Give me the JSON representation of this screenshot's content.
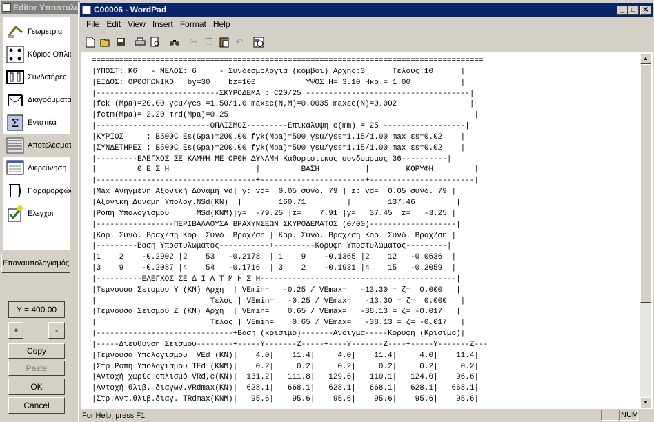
{
  "editor": {
    "title": "Editor Υποστυλω",
    "tools": [
      {
        "label": "Γεωμετρία",
        "icon": "geometry-icon"
      },
      {
        "label": "Κύριος Οπλισ",
        "icon": "main-rebar-icon"
      },
      {
        "label": "Συνδετήρες",
        "icon": "stirrups-icon"
      },
      {
        "label": "Διαγράμματα",
        "icon": "diagrams-icon"
      },
      {
        "label": "Εντατικά",
        "icon": "sum-icon"
      },
      {
        "label": "Αποτελέσματ",
        "icon": "results-icon"
      },
      {
        "label": "Διερεύνηση",
        "icon": "investigation-icon"
      },
      {
        "label": "Παραμορφώς",
        "icon": "deformation-icon"
      },
      {
        "label": "Ελεγχοι",
        "icon": "checks-icon"
      }
    ],
    "recalc_label": "Επαναυπολογισμός",
    "y_value": "Y = 400.00",
    "plus": "+",
    "minus": "-",
    "copy": "Copy",
    "paste": "Paste",
    "ok": "OK",
    "cancel": "Cancel"
  },
  "wordpad": {
    "title": "C00006 - WordPad",
    "menu": [
      "File",
      "Edit",
      "View",
      "Insert",
      "Format",
      "Help"
    ],
    "status": "For Help, press F1",
    "num": "NUM",
    "doc_lines": [
      "======================================================================================",
      "|ΥΠΟΣΤ: Κ6   - ΜΕΛΟΣ: 6     - Συνδεσμολογια (κομβοι) Αρχης:3      Τελους:10      |",
      "|ΕΙΔΟΣ: ΟΡΘΟΓΩΝΙΚΟ   by=30    bz=100           ΥΨΟΣ Η= 3.10 Ηκρ.= 1.00           |",
      "|---------------------------ΣΚΥΡΟΔΕΜΑ : C20/25 ------------------------------------|",
      "|fck (Mpa)=20.00 γcu/γcs =1.50/1.0 maxεc(N,M)=0.0035 maxεc(N)=0.002                |",
      "|fctm(Mpa)= 2.20 τrd(Mpa)=0.25                                                      |",
      "|-------------------------ΟΠΛΙΣΜΟΣ---------Επικαλυψη c(mm) = 25 ------------------|",
      "|ΚΥΡΙΟΣ     : B500C Es(Gpa)=200.00 fyk(Mpa)=500 γsu/γss=1.15/1.00 max εs=0.02    |",
      "|ΣΥΝΔΕΤΗΡΕΣ : B500C Es(Gpa)=200.00 fyk(Mpa)=500 γsu/γss=1.15/1.00 max εs=0.02    |",
      "|---------ΕΛΕΓΧΟΣ ΣΕ ΚΑΜΨΗ ΜΕ ΟΡΘΗ ΔΥΝΑΜΗ Καθοριστικος συνδυασμος 36----------|",
      "|         Θ Ε Σ Η                   |         ΒΑΣΗ          |        ΚΟΡΥΦΗ         |",
      "|-----------------------------------+-----------------------+-----------------------|",
      "|Max Ανηγμένη Αξονική Δύναμη vd| y: vd=  0.05 συνδ. 79 | z: vd=  0.05 συνδ. 79 |",
      "|Αξονικη Δυναμη Υπολογ.NSd(KN)  |        160.71         |        137.46         |",
      "|Ροπη Υπολογισμου      MSd(KNM)|y=  -79.25 |z=    7.91 |y=   37.45 |z=   -3.25 |",
      "|-----------------ΠΕΡΙΒΑΛΛΟΥΣΑ ΒΡΑΧΥΝΣΕΩΝ ΣΚΥΡΟΔΕΜΑΤΟΣ (0/00)-------------------|",
      "|Κορ. Συνδ. Βραχ/ση Κορ. Συνδ. Βραχ/ση | Κορ. Συνδ. Βραχ/ση Κορ. Συνδ. Βραχ/ση |",
      "|---------Βαση Υποστυλωματος-----------+---------Κορυφη Υποστυλωματος---------|",
      "|1    2    -0.2902 |2    53   -0.2178  | 1    9    -0.1365 |2    12   -0.0636  |",
      "|3    9    -0.2087 |4    54   -0.1716  | 3    2    -0.1931 |4    15   -0.2059  |",
      "|----------ΕΛΕΓΧΟΣ ΣΕ Δ Ι Α Τ Μ Η Σ Η-------------------------------------------|",
      "|Τεμνουσα Σεισμου Y (KN) Αρχη  | VEmin=   -0.25 / VEmax=   -13.30 = ζ=  0.000   |",
      "|                         Τελος | VEmin=   -0.25 / VEmax=   -13.30 = ζ=  0.000   |",
      "|Τεμνουσα Σεισμου Z (KN) Αρχη  | VEmin=    0.65 / VEmax=   -38.13 = ζ= -0.017   |",
      "|                         Τελος | VEmin=    0.65 / VEmax=   -38.13 = ζ= -0.017   |",
      "|------------------------------+Βαση (κρισιμο)-------Ανοιγμα-----Κορυφη (Κρισιμο)|",
      "|-----Διευθυνση Σεισμου--------+-----Y-------Z-----+----Y-------Z----+-----Y-------Z---|",
      "|Τεμνουσα Υπολογισμου  VEd (KN)|    4.0|    11.4|     4.0|    11.4|     4.0|    11.4|",
      "|Στρ.Ροπη Υπολογισμου TEd (KNM)|    0.2|     0.2|     0.2|     0.2|     0.2|     0.2|",
      "|Αντοχή χωρίς οπλισμό VRd,c(KN)|  131.2|   111.8|   129.6|   110.1|   124.0|    96.6|",
      "|Αντοχή θλιβ. διαγων.VRdmax(KN)|  628.1|   668.1|   628.1|   668.1|   628.1|   668.1|",
      "|Στρ.Αντ.θλιβ.διαγ. TRdmax(KNM)|   95.6|    95.6|    95.6|    95.6|    95.6|    95.6|"
    ]
  }
}
